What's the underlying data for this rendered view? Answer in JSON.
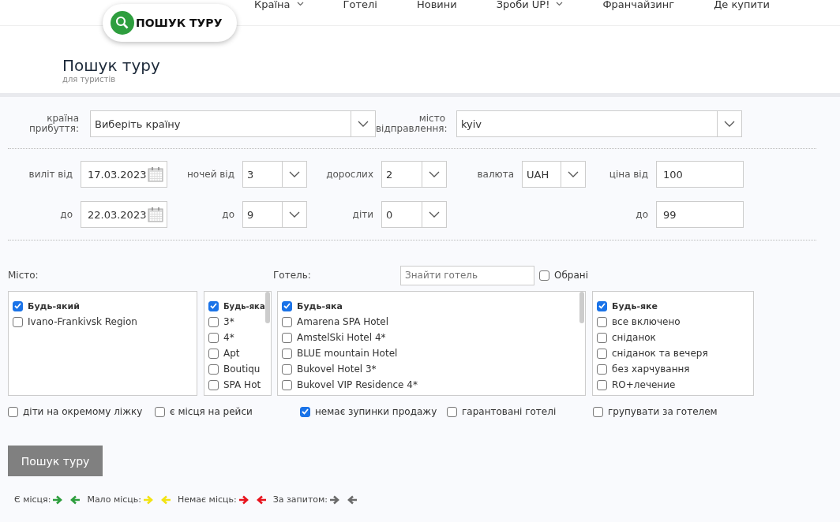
{
  "nav": [
    {
      "label": "Країна",
      "dropdown": true
    },
    {
      "label": "Готелі",
      "dropdown": false
    },
    {
      "label": "Новини",
      "dropdown": false
    },
    {
      "label": "Зроби UP!",
      "dropdown": true
    },
    {
      "label": "Франчайзинг",
      "dropdown": false
    },
    {
      "label": "Де купити",
      "dropdown": false
    }
  ],
  "logo": {
    "label": "ПОШУК ТУРУ"
  },
  "page": {
    "title": "Пошук туру",
    "subtitle": "для туристів"
  },
  "destination": {
    "country_label": "країна прибуття:",
    "country_value": "Виберіть країну",
    "city_label": "місто відправлення:",
    "city_value": "kyiv"
  },
  "departure_from": {
    "label": "виліт від",
    "value": "17.03.2023"
  },
  "departure_to": {
    "label": "до",
    "value": "22.03.2023"
  },
  "nights_from": {
    "label": "ночей від",
    "value": "3"
  },
  "nights_to": {
    "label": "до",
    "value": "9"
  },
  "adults": {
    "label": "дорослих",
    "value": "2"
  },
  "children": {
    "label": "діти",
    "value": "0"
  },
  "currency": {
    "label": "валюта",
    "value": "UAH"
  },
  "price_from": {
    "label": "ціна від",
    "value": "100"
  },
  "price_to": {
    "label": "до",
    "value": "99"
  },
  "city_list": {
    "label": "Місто:",
    "items": [
      {
        "label": "Будь-який",
        "checked": true
      },
      {
        "label": "Ivano-Frankivsk Region",
        "checked": false
      }
    ]
  },
  "category_list": {
    "items": [
      {
        "label": "Будь-яка",
        "checked": true
      },
      {
        "label": "3*",
        "checked": false
      },
      {
        "label": "4*",
        "checked": false
      },
      {
        "label": "Apt",
        "checked": false
      },
      {
        "label": "Boutiqu",
        "checked": false
      },
      {
        "label": "SPA Hot",
        "checked": false
      }
    ]
  },
  "hotel_list": {
    "label": "Готель:",
    "search_placeholder": "Знайти готель",
    "favorites": {
      "label": "Обрані",
      "checked": false
    },
    "items": [
      {
        "label": "Будь-яка",
        "checked": true
      },
      {
        "label": "Amarena SPA Hotel",
        "checked": false
      },
      {
        "label": "AmstelSki Hotel 4*",
        "checked": false
      },
      {
        "label": "BLUE mountain Hotel",
        "checked": false
      },
      {
        "label": "Bukovel Hotel 3*",
        "checked": false
      },
      {
        "label": "Bukovel VIP Residence 4*",
        "checked": false
      }
    ]
  },
  "meal_list": {
    "items": [
      {
        "label": "Будь-яке",
        "checked": true
      },
      {
        "label": "все включено",
        "checked": false
      },
      {
        "label": "сніданок",
        "checked": false
      },
      {
        "label": "сніданок та вечеря",
        "checked": false
      },
      {
        "label": "без харчування",
        "checked": false
      },
      {
        "label": "RO+лечение",
        "checked": false
      }
    ]
  },
  "options": [
    {
      "label": "діти на окремому ліжку",
      "checked": false
    },
    {
      "label": "є місця на рейси",
      "checked": false
    },
    {
      "label": "немає зупинки продажу",
      "checked": true
    },
    {
      "label": "гарантовані готелі",
      "checked": false
    },
    {
      "label": "групувати за готелем",
      "checked": false
    }
  ],
  "search_button": "Пошук туру",
  "legend": [
    {
      "label": "Є місця:",
      "color": "#2e9e3e"
    },
    {
      "label": "Мало місць:",
      "color": "#f2e313"
    },
    {
      "label": "Немає місць:",
      "color": "#e8141e"
    },
    {
      "label": "За запитом:",
      "color": "#6b6b6b"
    }
  ]
}
